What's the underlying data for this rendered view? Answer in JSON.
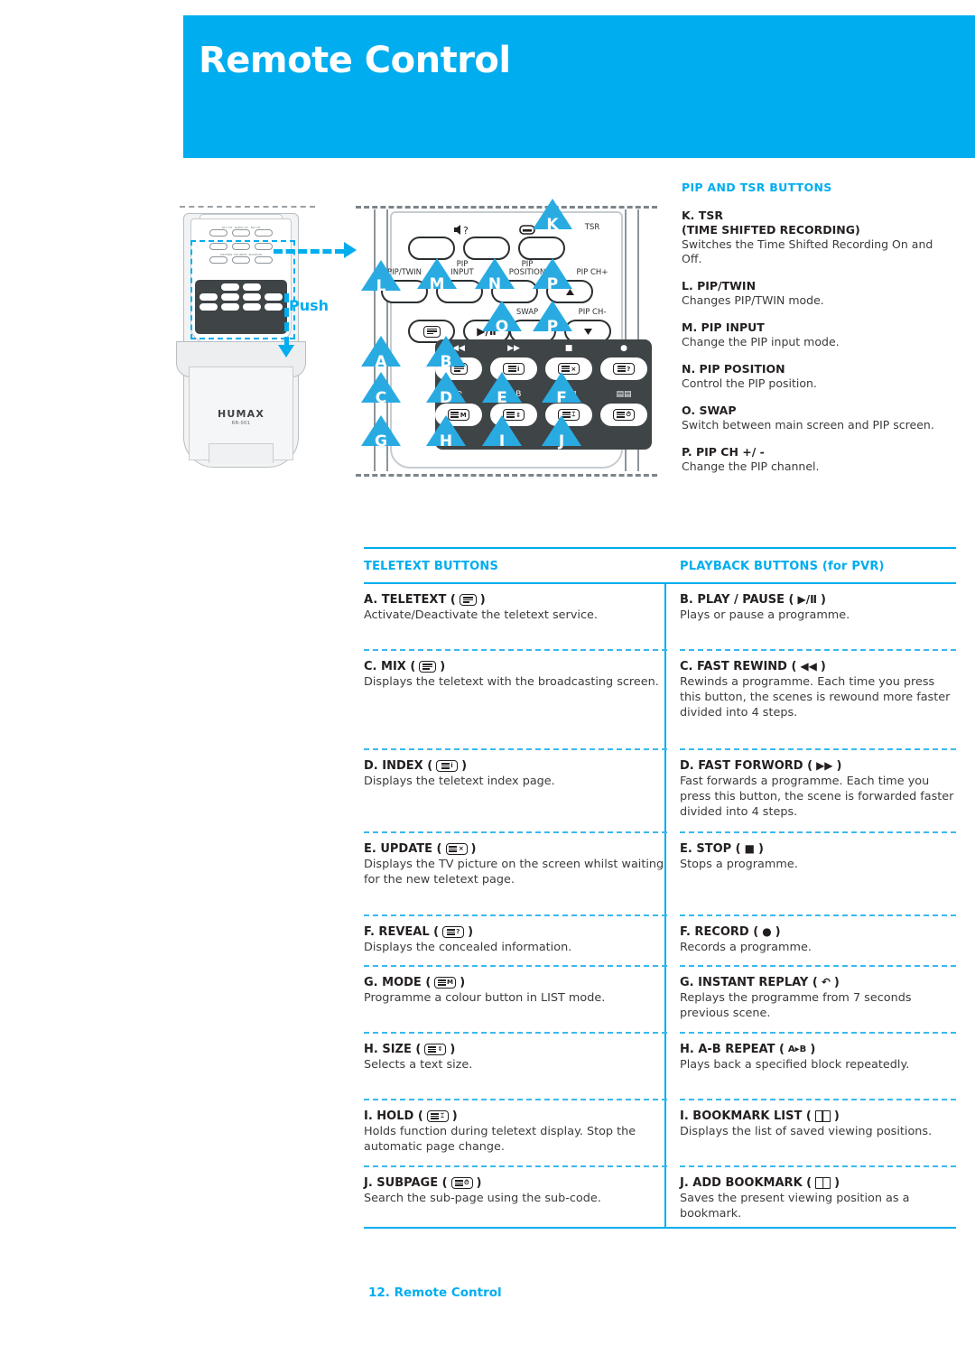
{
  "header": {
    "title": "Remote Control"
  },
  "colors": {
    "brand": "#00ADEF",
    "marker": "#29ABE2",
    "dark_pad": "#3F4447",
    "text": "#231F20"
  },
  "remote_small": {
    "brand_logo": "HUMAX",
    "model": "RR-001",
    "push_label": "Push"
  },
  "remote_diagram": {
    "labels": {
      "mute": "?",
      "tsr": "TSR",
      "pip_twin": "PIP/TWIN",
      "pip_input_1": "PIP",
      "pip_input_2": "INPUT",
      "pip_position_1": "PIP",
      "pip_position_2": "POSITION",
      "pip_ch_plus": "PIP CH+",
      "swap": "SWAP",
      "pip_ch_minus": "PIP CH-",
      "ab": "A▸B",
      "play_pause": "▶/Ⅱ"
    },
    "markers": [
      "A",
      "B",
      "C",
      "D",
      "E",
      "F",
      "G",
      "H",
      "I",
      "J",
      "K",
      "L",
      "M",
      "N",
      "O",
      "P"
    ]
  },
  "pip_tsr": {
    "heading": "PIP AND TSR BUTTONS",
    "items": [
      {
        "title": "K. TSR",
        "title2": "(TIME SHIFTED RECORDING)",
        "desc": "Switches the Time Shifted Recording On and Off."
      },
      {
        "title": "L. PIP/TWIN",
        "desc": "Changes PIP/TWIN mode."
      },
      {
        "title": "M. PIP INPUT",
        "desc": "Change the PIP input mode."
      },
      {
        "title": "N. PIP POSITION",
        "desc": "Control the PIP position."
      },
      {
        "title": "O. SWAP",
        "desc": "Switch between main screen and PIP screen."
      },
      {
        "title": "P. PIP CH +/ -",
        "desc": "Change the PIP channel."
      }
    ]
  },
  "table": {
    "headers": {
      "left": "TELETEXT BUTTONS",
      "right": "PLAYBACK BUTTONS (for PVR)"
    },
    "teletext": [
      {
        "label": "A. TELETEXT (",
        "close": ")",
        "icon": "teletext-icon",
        "desc": "Activate/Deactivate the teletext service."
      },
      {
        "label": "C. MIX (",
        "close": ")",
        "icon": "mix-icon",
        "desc": "Displays the teletext with the broadcasting screen."
      },
      {
        "label": "D. INDEX (",
        "close": ")",
        "icon": "index-icon",
        "desc": "Displays the teletext index page."
      },
      {
        "label": "E. UPDATE (",
        "close": ")",
        "icon": "update-icon",
        "desc": "Displays the TV picture on the screen whilst waiting for the new teletext page."
      },
      {
        "label": "F. REVEAL (",
        "close": ")",
        "icon": "reveal-icon",
        "desc": "Displays the concealed information."
      },
      {
        "label": "G. MODE (",
        "close": ")",
        "icon": "mode-icon",
        "desc": "Programme a colour button in LIST mode."
      },
      {
        "label": "H. SIZE (",
        "close": ")",
        "icon": "size-icon",
        "desc": "Selects a text size."
      },
      {
        "label": "I. HOLD (",
        "close": ")",
        "icon": "hold-icon",
        "desc": "Holds function during teletext display. Stop the automatic page change."
      },
      {
        "label": "J. SUBPAGE (",
        "close": ")",
        "icon": "subpage-icon",
        "desc": "Search the sub-page using the sub-code."
      }
    ],
    "playback": [
      {
        "label": "B. PLAY / PAUSE (",
        "close": ")",
        "icon": "play-pause-icon",
        "glyph": "▶/Ⅱ",
        "desc": "Plays or pause a programme."
      },
      {
        "label": "C. FAST REWIND (",
        "close": ")",
        "icon": "fast-rewind-icon",
        "glyph": "◀◀",
        "desc": "Rewinds a programme. Each time you press this button, the scenes is rewound more faster divided into 4 steps."
      },
      {
        "label": "D. FAST FORWORD (",
        "close": ")",
        "icon": "fast-forward-icon",
        "glyph": "▶▶",
        "desc": "Fast forwards a programme. Each time you press this button, the scene is forwarded faster divided into 4 steps."
      },
      {
        "label": "E. STOP (",
        "close": ")",
        "icon": "stop-icon",
        "glyph": "■",
        "desc": "Stops a programme."
      },
      {
        "label": "F. RECORD (",
        "close": ")",
        "icon": "record-icon",
        "glyph": "●",
        "desc": "Records a programme."
      },
      {
        "label": "G. INSTANT REPLAY (",
        "close": ")",
        "icon": "instant-replay-icon",
        "glyph": "↶",
        "desc": "Replays the programme from 7 seconds previous scene."
      },
      {
        "label": "H. A-B REPEAT (",
        "close": ")",
        "icon": "ab-repeat-icon",
        "glyph": "A▸B",
        "desc": "Plays back a specified block repeatedly."
      },
      {
        "label": "I. BOOKMARK LIST (",
        "close": ")",
        "icon": "bookmark-list-icon",
        "glyph": "",
        "desc": "Displays the list of saved viewing positions."
      },
      {
        "label": "J. ADD BOOKMARK (",
        "close": ")",
        "icon": "add-bookmark-icon",
        "glyph": "",
        "desc": "Saves the present viewing position as a bookmark."
      }
    ]
  },
  "footer": {
    "text": "12. Remote Control"
  }
}
